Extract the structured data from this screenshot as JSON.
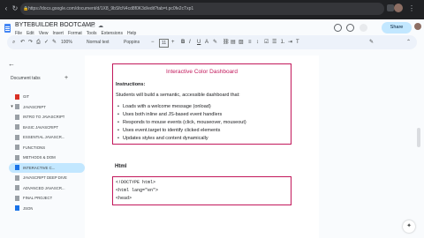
{
  "browser": {
    "url": "https://docs.google.com/document/d/1X8_9bSfcN4cd8f0K3d/edit?tab=t.pc0fe2cTxp1"
  },
  "doc": {
    "title": "BYTEBUILDER BOOTCAMP",
    "menu": [
      "File",
      "Edit",
      "View",
      "Insert",
      "Format",
      "Tools",
      "Extensions",
      "Help"
    ],
    "share_label": "Share"
  },
  "toolbar": {
    "zoom": "100%",
    "style": "Normal text",
    "font": "Poppins",
    "size": "11"
  },
  "sidebar": {
    "tabs_label": "Document tabs",
    "items": [
      {
        "label": "GIT",
        "chevron": "",
        "color": "#d93025",
        "active": false
      },
      {
        "label": "JAVASCRIPT",
        "chevron": "▾",
        "color": "#9aa0a6",
        "active": false
      },
      {
        "label": "INTRO TO JAVASCRIPT",
        "chevron": "",
        "color": "#9aa0a6",
        "active": false
      },
      {
        "label": "BASIC JAVASCRIPT",
        "chevron": "",
        "color": "#9aa0a6",
        "active": false
      },
      {
        "label": "ESSENTIAL JAVASCR...",
        "chevron": "",
        "color": "#9aa0a6",
        "active": false
      },
      {
        "label": "FUNCTIONS",
        "chevron": "",
        "color": "#9aa0a6",
        "active": false
      },
      {
        "label": "METHODS & DOM",
        "chevron": "",
        "color": "#9aa0a6",
        "active": false
      },
      {
        "label": "INTERACTIVE C...",
        "chevron": "",
        "color": "#1a73e8",
        "active": true
      },
      {
        "label": "JAVASCRIPT DEEP DIVE",
        "chevron": "",
        "color": "#9aa0a6",
        "active": false
      },
      {
        "label": "ADVANCED JAVASCR...",
        "chevron": "",
        "color": "#9aa0a6",
        "active": false
      },
      {
        "label": "FINAL PROJECT",
        "chevron": "",
        "color": "#9aa0a6",
        "active": false
      },
      {
        "label": "JSON",
        "chevron": "",
        "color": "#1a73e8",
        "active": false
      }
    ]
  },
  "content": {
    "box_title": "Interactive Color Dashboard",
    "instructions_heading": "Instructions:",
    "intro": "Students will build a semantic, accessible dashboard that:",
    "bullets": [
      "Loads with a welcome message (onload)",
      "Uses both inline and JS-based event handlers",
      "Responds to mouse events (click, mouseover, mouseout)",
      "Uses event.target to identify clicked elements",
      "Updates styles and content dynamically"
    ],
    "html_heading": "Html",
    "code_lines": [
      "<!DOCTYPE html>",
      "<html lang=\"en\">",
      "<head>"
    ]
  },
  "colors": {
    "accent": "#c2185b",
    "share_bg": "#c2e7ff"
  }
}
